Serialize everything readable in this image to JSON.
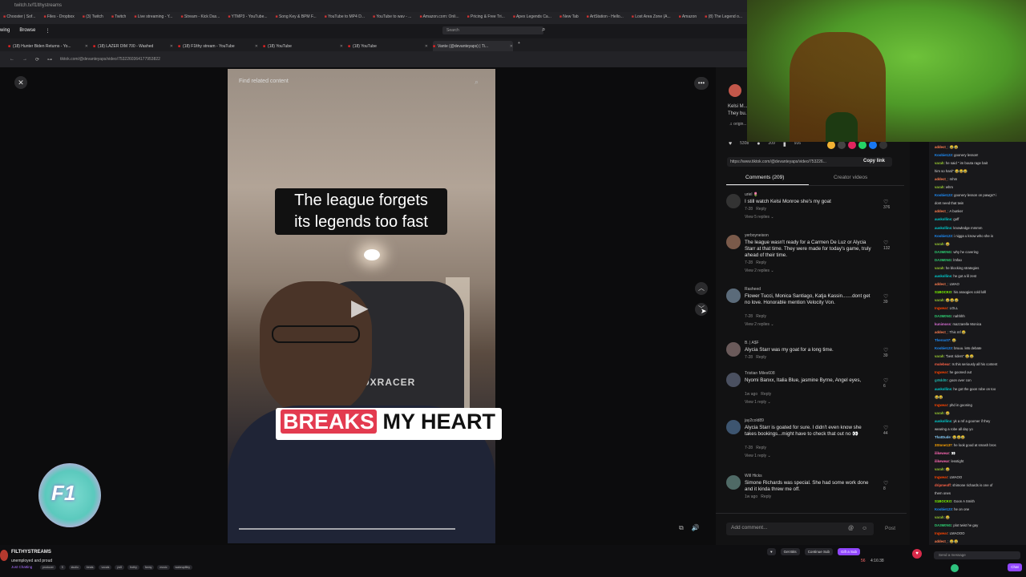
{
  "browser": {
    "os_title": "twitch.tv/f1lthystreams",
    "bookmarks": [
      "Chooster | Sof...",
      "Files - Dropbox",
      "(3) Twitch",
      "Twitch",
      "Live streaming - Y...",
      "Stream - Kick Das...",
      "YTMP3 - YouTube...",
      "Song Key & BPM F...",
      "YouTube to MP4 D...",
      "YouTube to wav - ...",
      "Amazon.com: Onli...",
      "Pricing & Free Tri...",
      "Apex Legends Ca...",
      "New Tab",
      "ArtStation - Hello...",
      "Lost Area Zone (A...",
      "Amazon",
      "(8) The Legend o...",
      "Kanye West Conte...",
      "Visually Plan, Man..."
    ],
    "nav_left": [
      "wing",
      "Browse",
      "⋮"
    ],
    "search_placeholder": "Search",
    "tabs": [
      {
        "label": "(18) Hunter Biden Returns - Yo...",
        "active": false
      },
      {
        "label": "(18) LAZER DIM 700 - Washed",
        "active": false
      },
      {
        "label": "(18) F1lthy stream - YouTube",
        "active": false
      },
      {
        "label": "(18) YouTube",
        "active": false
      },
      {
        "label": "(18) YouTube",
        "active": false
      },
      {
        "label": "Vante (@devanteyaps) | Ti...",
        "active": true
      }
    ],
    "url": "tiktok.com/@devanteyaps/video/7532260364177953822"
  },
  "video": {
    "search_placeholder": "Find related content",
    "caption_top_line1": "The league forgets",
    "caption_top_line2": "its legends too fast",
    "caption_bottom_highlight": "BREAKS",
    "caption_bottom_rest": " MY HEART",
    "chair_logo": "DXRACER"
  },
  "sticker": {
    "text": "F1"
  },
  "post": {
    "desc_line1": "Kelsi M...",
    "desc_line2": "They bu...",
    "music": "♫ origin...",
    "likes": "5308",
    "comments": "209",
    "saves": "916",
    "link": "https://www.tiktok.com/@devanteyaps/video/753226...",
    "copy_link": "Copy link",
    "tab_comments": "Comments (209)",
    "tab_creator": "Creator videos"
  },
  "comments": [
    {
      "user": "uriel 🌷",
      "text": "I still watch Kelsi Monroe she's my goat",
      "date": "7-28",
      "reply": "Reply",
      "views": "View 5 replies ⌄",
      "likes": "376"
    },
    {
      "user": "yerboyneison",
      "text": "The league wasn't ready for a Carmen De Luz or Alycia Starr at that time. They were made for today's game, truly ahead of their time.",
      "date": "7-28",
      "reply": "Reply",
      "views": "View 2 replies ⌄",
      "likes": "132"
    },
    {
      "user": "Rasheed",
      "text": "Flower Tucci, Monica Santiago, Katja Kassin.......dont get no love. Honorable mention Velocity Von.",
      "date": "7-28",
      "reply": "Reply",
      "views": "View 2 replies ⌄",
      "likes": "39"
    },
    {
      "user": "B. | A$F",
      "text": "Alycia Starr was my goat for a long time.",
      "date": "7-28",
      "reply": "Reply",
      "views": "",
      "likes": "39"
    },
    {
      "user": "Tristian Miles608",
      "text": "Nyomi Banxx, Italia Blue, jasmine Byrne, Angel eyes,",
      "date": "1w ago",
      "reply": "Reply",
      "views": "View 1 reply ⌄",
      "likes": "6"
    },
    {
      "user": "jay2cold89",
      "text": "Alycia Starr is goated for sure. I didn't even know she takes bookings...might have to check that out no 👀",
      "date": "7-28",
      "reply": "Reply",
      "views": "View 1 reply ⌄",
      "likes": "44"
    },
    {
      "user": "Will Hicks",
      "text": "Simone Richards was special. She had some work done and it kinda threw me off.",
      "date": "1w ago",
      "reply": "Reply",
      "views": "",
      "likes": "8"
    }
  ],
  "add_comment": {
    "placeholder": "Add comment...",
    "at": "@",
    "emoji": "☺",
    "post": "Post"
  },
  "chat": {
    "lines": [
      {
        "user": "addect_",
        "text": ": 😂😂",
        "color": "#ff7f50"
      },
      {
        "user": "Koobie123",
        "text": ": goonery lesson!",
        "color": "#1e90ff"
      },
      {
        "user": "varah",
        "text": ": he said \" im bouta rage bait",
        "color": "#9acd32"
      },
      {
        "user": "",
        "text": "him so hard\" 😂😂😂",
        "color": "#ddd"
      },
      {
        "user": "addect_",
        "text": ": mhm",
        "color": "#ff7f50"
      },
      {
        "user": "varah",
        "text": ": whm",
        "color": "#9acd32"
      },
      {
        "user": "Koobie123",
        "text": ": goonery lesson on pawgs? i",
        "color": "#1e90ff"
      },
      {
        "user": "",
        "text": "dont need that twin",
        "color": "#ddd"
      },
      {
        "user": "addect_",
        "text": ": A bunker",
        "color": "#ff7f50"
      },
      {
        "user": "auskollins",
        "text": ": goff",
        "color": "#00ced1"
      },
      {
        "user": "auskollins",
        "text": ": knowledge mmmm",
        "color": "#00ced1"
      },
      {
        "user": "Koobie123",
        "text": ": i nigga u know who she is",
        "color": "#1e90ff"
      },
      {
        "user": "varah",
        "text": ": 😂",
        "color": "#9acd32"
      },
      {
        "user": "DA3M0NG",
        "text": ": why he covering",
        "color": "#2ecc71"
      },
      {
        "user": "DA3M0NG",
        "text": ": lmfao",
        "color": "#2ecc71"
      },
      {
        "user": "varah",
        "text": ": he blocking strategies",
        "color": "#9acd32"
      },
      {
        "user": "auskollins",
        "text": ": he got a lil zest",
        "color": "#00ced1"
      },
      {
        "user": "addect_",
        "text": ": LMAO",
        "color": "#ff7f50"
      },
      {
        "user": "S1BOCKO",
        "text": ": his anaogies cold lolll",
        "color": "#7fff00"
      },
      {
        "user": "varah",
        "text": ": 😂😂😂",
        "color": "#9acd32"
      },
      {
        "user": "Ingwear",
        "text": ": LOLL",
        "color": "#ff4500"
      },
      {
        "user": "DA3M0NG",
        "text": ": nahhhh",
        "color": "#2ecc71"
      },
      {
        "user": "kunimoss",
        "text": ": mazzarelle Monica",
        "color": "#da70d6"
      },
      {
        "user": "addect_",
        "text": ": This mf 😂",
        "color": "#ff7f50"
      },
      {
        "user": "Therox07",
        "text": ": 😂",
        "color": "#1e90ff"
      },
      {
        "user": "Koobie123",
        "text": ": bruuu. lets debate",
        "color": "#1e90ff"
      },
      {
        "user": "varah",
        "text": ": \"best riders\" 😂😂",
        "color": "#9acd32"
      },
      {
        "user": "mulebear",
        "text": ": Is this seriously all his content",
        "color": "#ff6347"
      },
      {
        "user": "Ingwear",
        "text": ": he gooned out",
        "color": "#ff4500"
      },
      {
        "user": "gr8dd0r",
        "text": ": goon over con",
        "color": "#20b2aa"
      },
      {
        "user": "auskollins",
        "text": ": he got the goon robe on too",
        "color": "#00ced1"
      },
      {
        "user": "",
        "text": "😂😂",
        "color": "#ddd"
      },
      {
        "user": "Ingwear",
        "text": ": phd in gooning",
        "color": "#ff4500"
      },
      {
        "user": "varah",
        "text": ": 😂",
        "color": "#9acd32"
      },
      {
        "user": "auskollins",
        "text": ": yk a mf a goomer if they",
        "color": "#00ced1"
      },
      {
        "user": "",
        "text": "wearing a robe all day yo",
        "color": "#ddd"
      },
      {
        "user": "ThatDude",
        "text": ": 😂😂😂",
        "color": "#87cefa"
      },
      {
        "user": "3Stone137",
        "text": ": he look good at smash bros",
        "color": "#ffa500"
      },
      {
        "user": "ilikewear",
        "text": ": 👀",
        "color": "#ff69b4"
      },
      {
        "user": "ilikewear",
        "text": ": lesstight",
        "color": "#ff69b4"
      },
      {
        "user": "varah",
        "text": ": 😂",
        "color": "#9acd32"
      },
      {
        "user": "Ingwear",
        "text": ": LMAOO",
        "color": "#ff4500"
      },
      {
        "user": "dripmeoff",
        "text": ": shimone richards is one of",
        "color": "#ff6347"
      },
      {
        "user": "",
        "text": "them ones",
        "color": "#ddd"
      },
      {
        "user": "S1BOCKO",
        "text": ": Goon A Smith",
        "color": "#7fff00"
      },
      {
        "user": "Koobie123",
        "text": ": he on one",
        "color": "#1e90ff"
      },
      {
        "user": "varah",
        "text": ": 😂",
        "color": "#9acd32"
      },
      {
        "user": "DA3M0NG",
        "text": ": plot twist he gay",
        "color": "#2ecc71"
      },
      {
        "user": "Ingwear",
        "text": ": LMAOOO",
        "color": "#ff4500"
      },
      {
        "user": "addect_",
        "text": ": 😂😂",
        "color": "#ff7f50"
      }
    ],
    "input_placeholder": "Send a message",
    "chat_button": "Chat"
  },
  "stream": {
    "name": "FILTHYSTREAMS",
    "title": "unemployed and proud",
    "category": "Just Chatting",
    "tags": [
      "producer",
      "fl",
      "studio",
      "beats",
      "vocals",
      "ps5",
      "frothy",
      "fanny",
      "music",
      "wakeupfiltry"
    ],
    "actions": [
      "♥",
      "Get Bits",
      "Continue Sub",
      "Gift a Sub"
    ],
    "viewers": "56",
    "uptime": "4:16:38"
  }
}
